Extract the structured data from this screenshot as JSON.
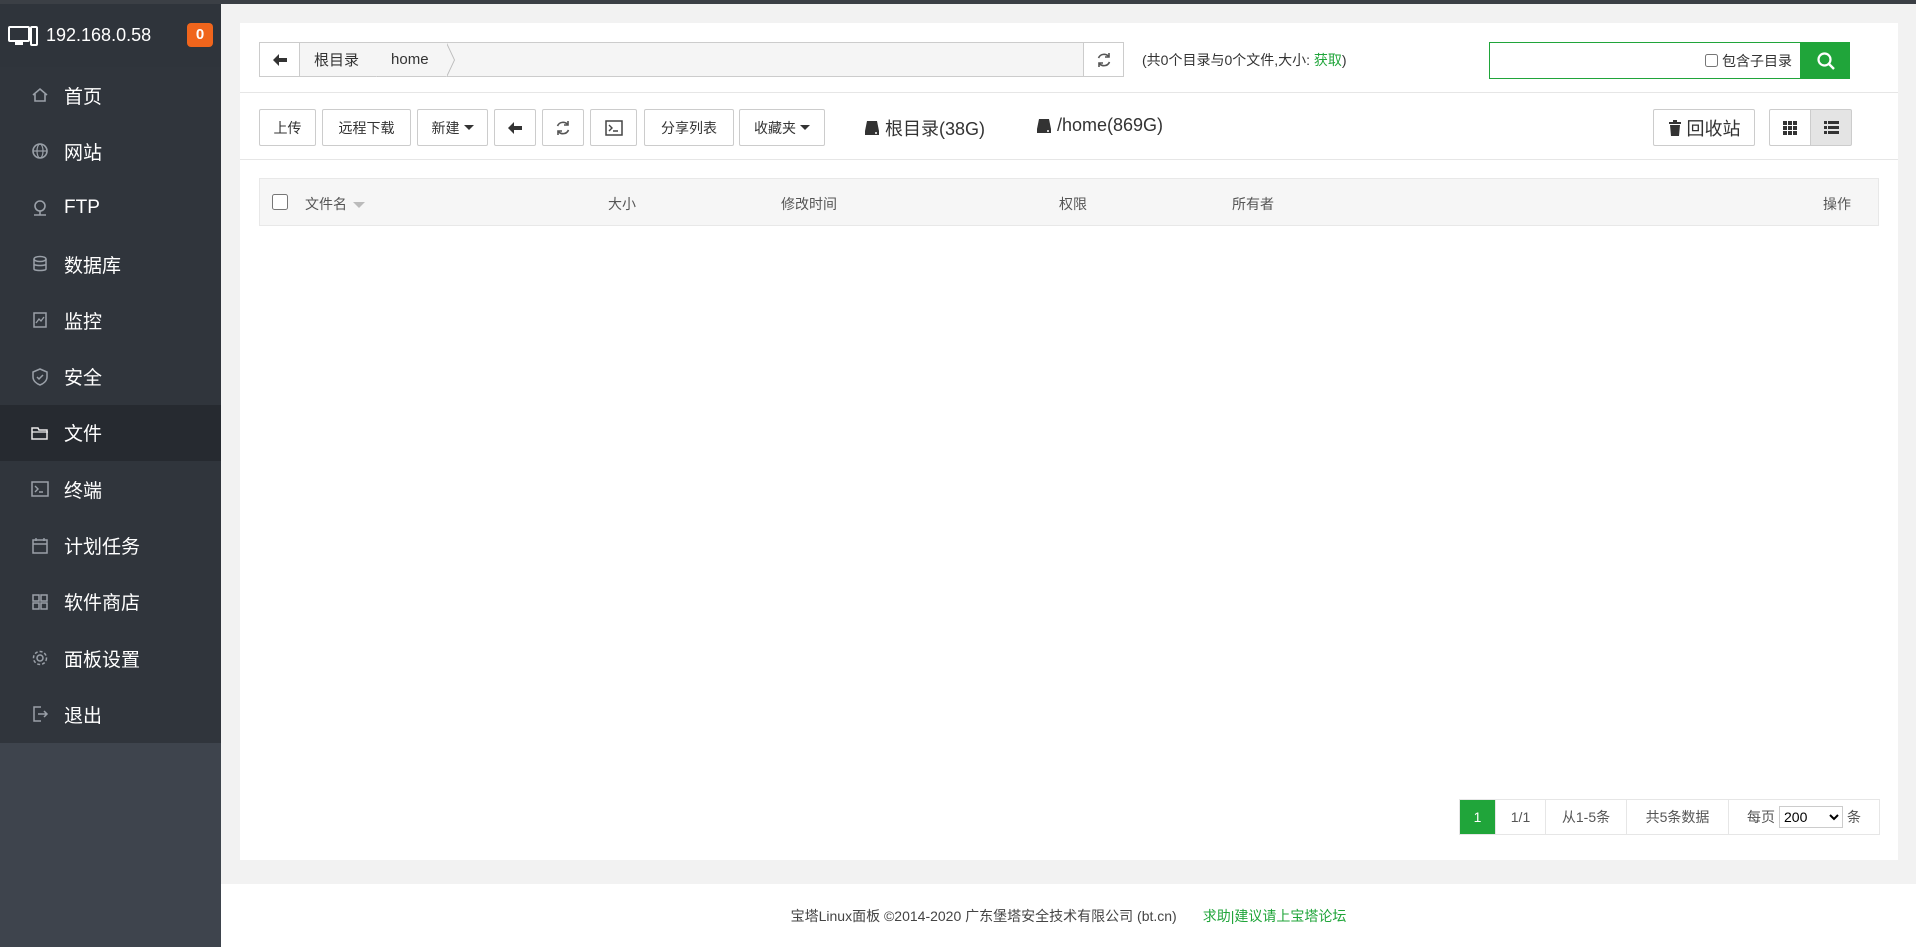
{
  "server": {
    "ip": "192.168.0.58",
    "badge": "0"
  },
  "menu": [
    {
      "label": "首页",
      "icon": "home-icon"
    },
    {
      "label": "网站",
      "icon": "globe-icon"
    },
    {
      "label": "FTP",
      "icon": "ftp-icon"
    },
    {
      "label": "数据库",
      "icon": "database-icon"
    },
    {
      "label": "监控",
      "icon": "monitor-icon"
    },
    {
      "label": "安全",
      "icon": "shield-icon"
    },
    {
      "label": "文件",
      "icon": "folder-icon",
      "active": true
    },
    {
      "label": "终端",
      "icon": "terminal-icon"
    },
    {
      "label": "计划任务",
      "icon": "calendar-icon"
    },
    {
      "label": "软件商店",
      "icon": "grid-icon"
    },
    {
      "label": "面板设置",
      "icon": "gear-icon"
    },
    {
      "label": "退出",
      "icon": "logout-icon"
    }
  ],
  "breadcrumb": {
    "root": "根目录",
    "home": "home"
  },
  "count_info": {
    "text": "(共0个目录与0个文件,大小: ",
    "fetch": "获取",
    "close": ")"
  },
  "search": {
    "value": "",
    "sub_label": "包含子目录"
  },
  "toolbar": {
    "upload": "上传",
    "remote_download": "远程下载",
    "new": "新建",
    "share_list": "分享列表",
    "favorites": "收藏夹",
    "recycle": "回收站"
  },
  "disks": [
    {
      "label": "根目录(38G)"
    },
    {
      "label": "/home(869G)"
    }
  ],
  "table": {
    "columns": {
      "name": "文件名",
      "size": "大小",
      "mtime": "修改时间",
      "perm": "权限",
      "owner": "所有者",
      "ops": "操作"
    }
  },
  "pager": {
    "current": "1",
    "pages": "1/1",
    "range": "从1-5条",
    "total": "共5条数据",
    "per_page_label": "每页",
    "per_page": "200",
    "unit": "条"
  },
  "footer": {
    "copyright": "宝塔Linux面板 ©2014-2020 广东堡塔安全技术有限公司 (bt.cn)",
    "link": "求助|建议请上宝塔论坛"
  },
  "colors": {
    "accent": "#20a53a",
    "sidebar": "#30353c",
    "badge": "#f0651c"
  }
}
